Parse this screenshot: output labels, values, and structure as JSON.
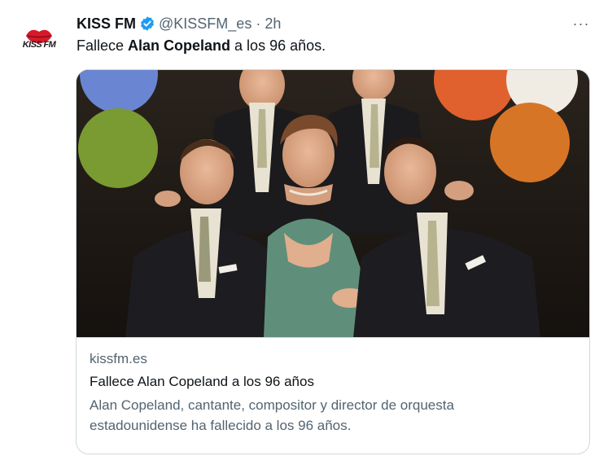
{
  "author": {
    "name": "KISS FM",
    "handle": "@KISSFM_es",
    "separator": "·",
    "time": "2h",
    "avatar_text": "KISS FM",
    "verified": true
  },
  "more_menu": {
    "label": "···"
  },
  "tweet": {
    "text_before": "Fallece ",
    "text_bold": "Alan Copeland",
    "text_after": " a los 96 años."
  },
  "card": {
    "image_alt": "",
    "domain": "kissfm.es",
    "title": "Fallece Alan Copeland a los 96 años",
    "description": "Alan Copeland, cantante, compositor y director de orquesta estadounidense ha fallecido a los 96 años."
  },
  "colors": {
    "text_primary": "#0f1419",
    "text_secondary": "#536471",
    "verified_blue": "#1d9bf0",
    "border": "#cfd9de",
    "kiss_red": "#d7192b"
  },
  "icons": {
    "verified": "verified-badge-icon",
    "more": "more-horizontal-icon",
    "lips": "kiss-lips-logo"
  }
}
